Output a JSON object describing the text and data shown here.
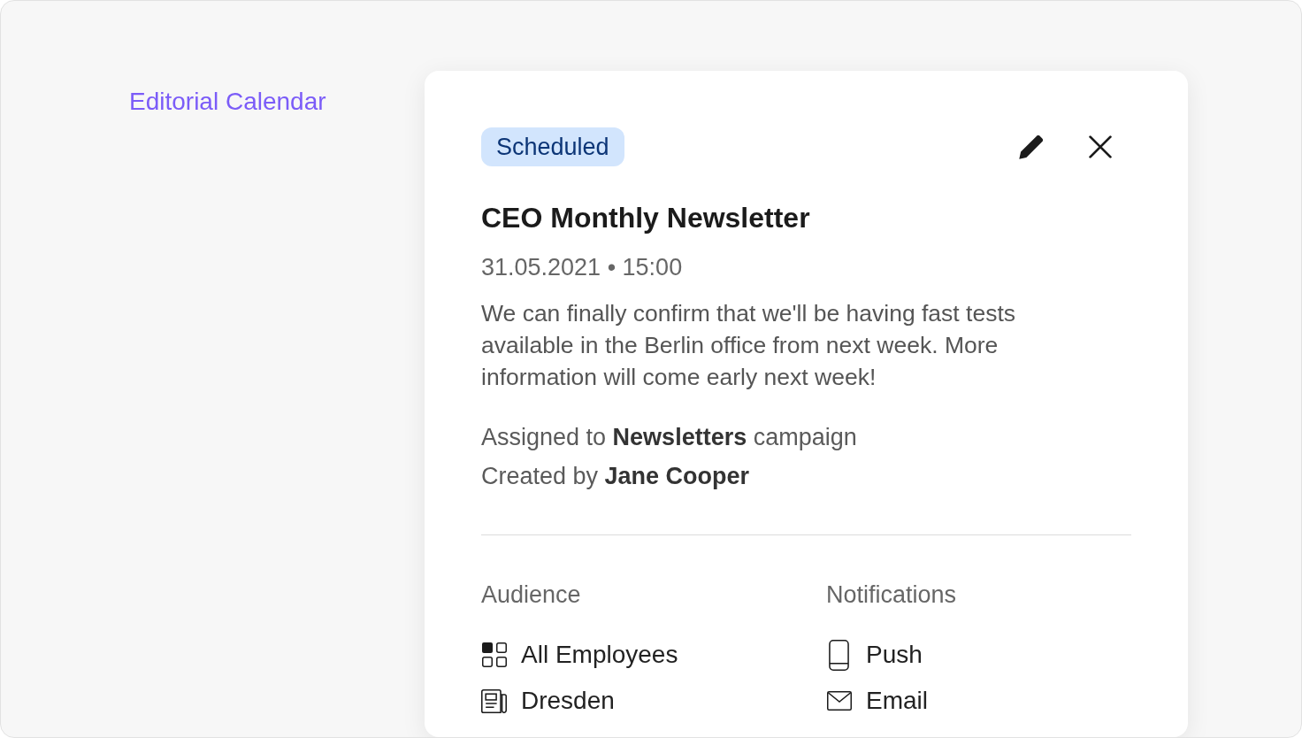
{
  "sidebar": {
    "link": "Editorial Calendar"
  },
  "event": {
    "status": {
      "label": "Scheduled",
      "kind": "scheduled"
    },
    "title": "CEO Monthly Newsletter",
    "datetime": "31.05.2021 • 15:00",
    "description": "We can finally confirm that we'll be having fast tests available in the Berlin office from next week. More information will come early next week!",
    "assigned": "Assigned to **Newsletters** campaign",
    "created": "Created by **Jane Cooper**",
    "audience": {
      "title": "Audience",
      "items": [
        {
          "label": "All Employees",
          "kind": "group"
        },
        {
          "label": "Dresden",
          "kind": "location"
        }
      ]
    },
    "notifications": {
      "title": "Notifications",
      "items": [
        {
          "label": "Push",
          "kind": "push"
        },
        {
          "label": "Email",
          "kind": "email"
        }
      ]
    }
  }
}
